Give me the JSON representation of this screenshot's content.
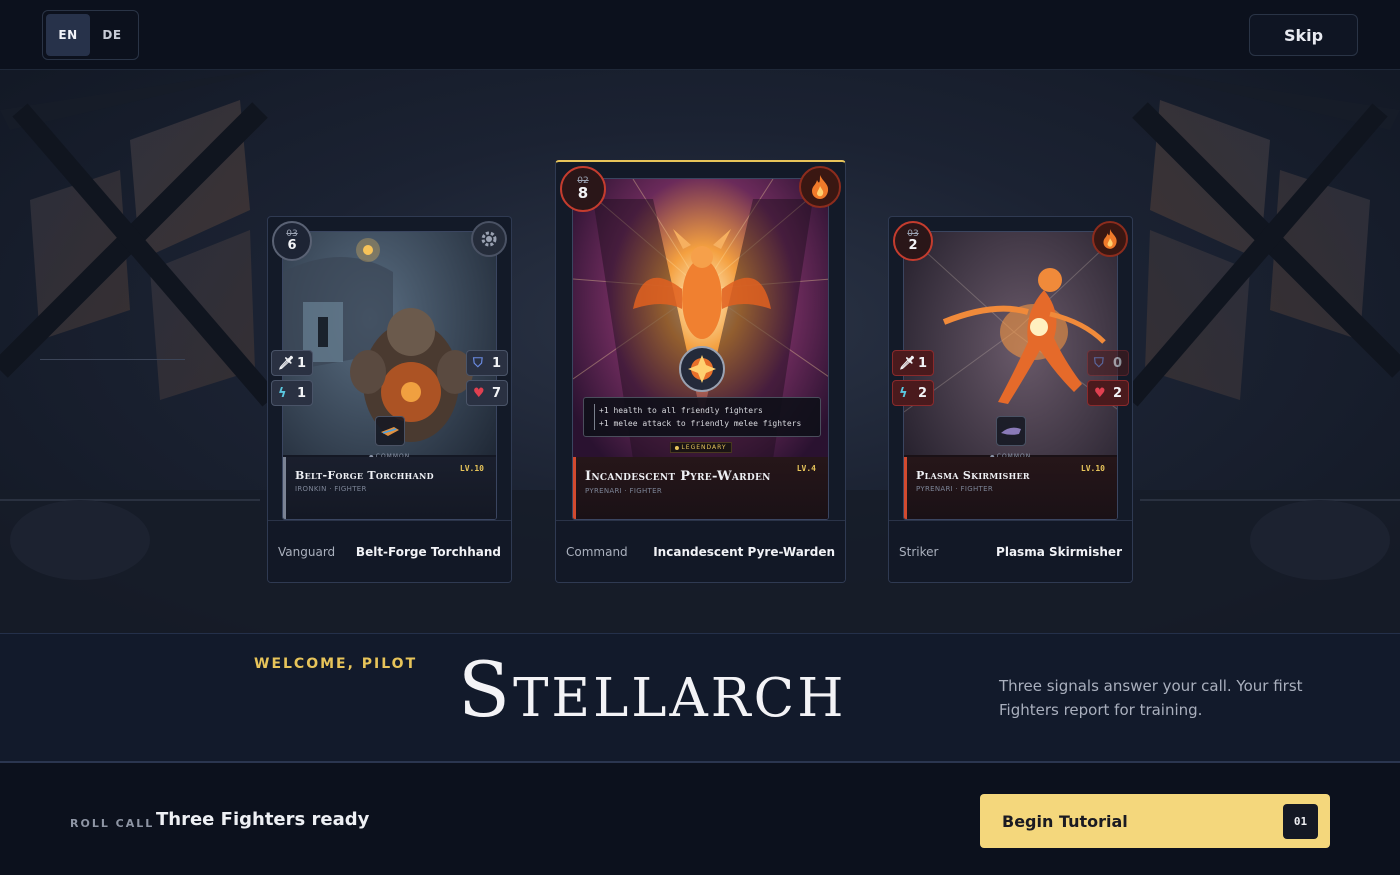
{
  "topbar": {
    "languages": [
      {
        "code": "EN",
        "active": true
      },
      {
        "code": "DE",
        "active": false
      }
    ],
    "skip_label": "Skip"
  },
  "cards": [
    {
      "role": "Vanguard",
      "name": "Belt-Forge Torchhand",
      "title_card": "Belt-Forge Torchhand",
      "subtitle": "IRONKIN · FIGHTER",
      "level": "LV.10",
      "rarity": "COMMON",
      "cost_old": "03",
      "cost_new": "6",
      "element": "gear",
      "stats": {
        "attack": "1",
        "energy": "1",
        "shield": "1",
        "health": "7"
      }
    },
    {
      "role": "Command",
      "name": "Incandescent Pyre-Warden",
      "title_card": "Incandescent Pyre-Warden",
      "subtitle": "PYRENARI · FIGHTER",
      "level": "LV.4",
      "rarity": "LEGENDARY",
      "cost_old": "02",
      "cost_new": "8",
      "element": "fire",
      "abilities": [
        "+1 health to all friendly fighters",
        "+1 melee attack to friendly melee fighters"
      ]
    },
    {
      "role": "Striker",
      "name": "Plasma Skirmisher",
      "title_card": "Plasma Skirmisher",
      "subtitle": "PYRENARI · FIGHTER",
      "level": "LV.10",
      "rarity": "COMMON",
      "cost_old": "03",
      "cost_new": "2",
      "element": "fire",
      "stats": {
        "attack": "1",
        "energy": "2",
        "shield": "0",
        "health": "2"
      }
    }
  ],
  "hero": {
    "welcome": "WELCOME, PILOT",
    "title": "Stellarch",
    "tagline": "Three signals answer your call. Your first Fighters report for training."
  },
  "footer": {
    "roll_call_label": "ROLL CALL",
    "roll_call_value": "Three Fighters ready",
    "begin_label": "Begin Tutorial",
    "begin_key": "01"
  },
  "colors": {
    "accent_gold": "#e7c45a",
    "button_gold": "#f4d77c",
    "fire_red": "#c43c2e",
    "background": "#0d1220"
  }
}
